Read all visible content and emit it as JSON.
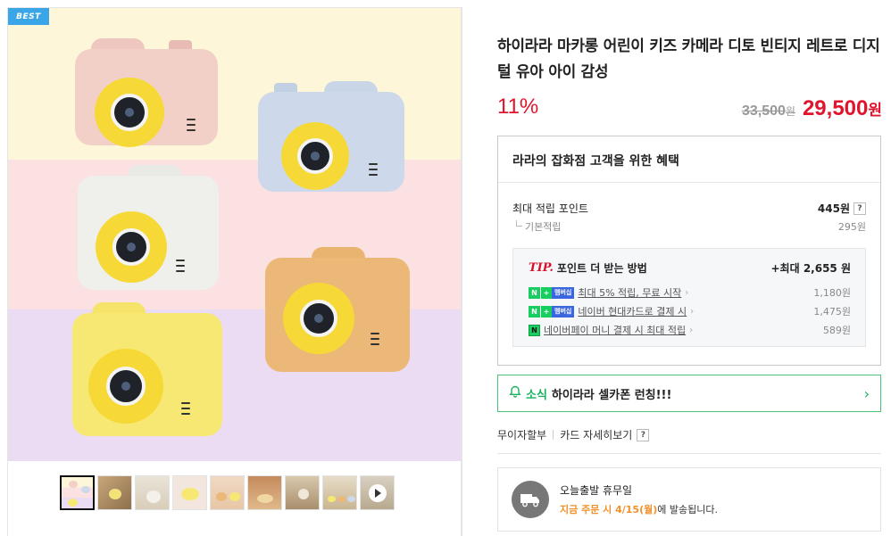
{
  "badge": "BEST",
  "product": {
    "title": "하이라라 마카롱 어린이 키즈 카메라 디토 빈티지 레트로 디지털 유아 아이 감성",
    "discount": "11%",
    "original_price": "33,500",
    "original_unit": "원",
    "sale_price": "29,500",
    "sale_unit": "원"
  },
  "benefits": {
    "header": "라라의 잡화점 고객을 위한 혜택",
    "max_point_label": "최대 적립 포인트",
    "max_point_value": "445원",
    "base_label": "기본적립",
    "base_value": "295원",
    "tip": {
      "tip_word": "TIP.",
      "title": "포인트 더 받는 방법",
      "max_label": "+최대 2,655 원",
      "rows": [
        {
          "badge_n": "N",
          "badge_plus": "+",
          "badge_member": "멤버십",
          "text": "최대 5% 적립, 무료 시작",
          "value": "1,180원"
        },
        {
          "badge_n": "N",
          "badge_plus": "+",
          "badge_member": "멤버십",
          "text": "네이버 현대카드로 결제 시",
          "value": "1,475원"
        },
        {
          "badge_n": "N",
          "text": "네이버페이 머니 결제 시 최대 적립",
          "value": "589원"
        }
      ]
    }
  },
  "notice": {
    "tag": "소식",
    "message": "하이라라 셀카폰 런칭!!!"
  },
  "links": {
    "installment": "무이자할부",
    "card_detail": "카드 자세히보기",
    "help": "?"
  },
  "shipping": {
    "line1": "오늘출발 휴무일",
    "highlight": "지금 주문 시 4/15(월)",
    "suffix": "에 발송됩니다."
  },
  "thumbnails": [
    "thumb-1",
    "thumb-2",
    "thumb-3",
    "thumb-4",
    "thumb-5",
    "thumb-6",
    "thumb-7",
    "thumb-8",
    "thumb-video"
  ],
  "colors": {
    "accent_red": "#e1142d",
    "green": "#19b25b",
    "naver_green": "#19ce60",
    "best_badge": "#3aa6e8"
  }
}
